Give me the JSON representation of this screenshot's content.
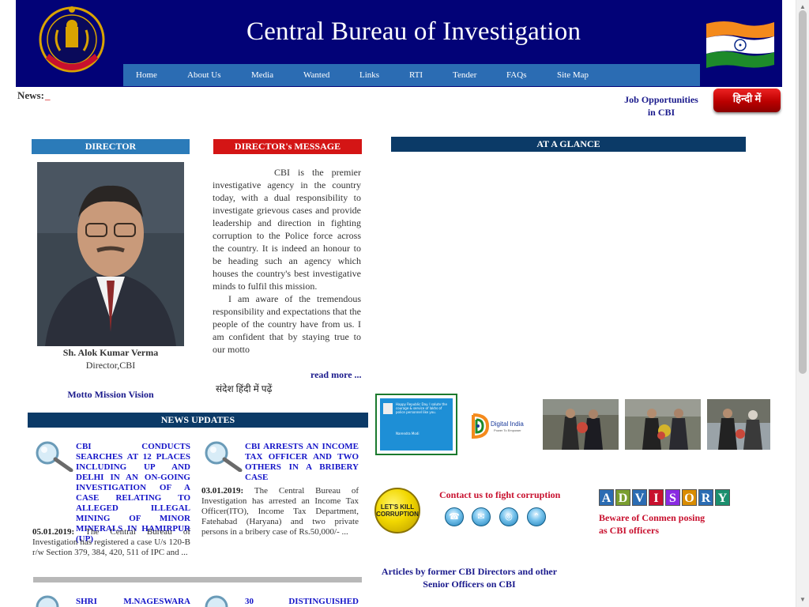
{
  "header": {
    "title": "Central Bureau of Investigation",
    "logo_icon": "cbi-emblem-icon",
    "flag_icon": "india-flag-icon",
    "nav": [
      {
        "label": "Home"
      },
      {
        "label": "About Us"
      },
      {
        "label": "Media"
      },
      {
        "label": "Wanted"
      },
      {
        "label": "Links"
      },
      {
        "label": "RTI"
      },
      {
        "label": "Tender"
      },
      {
        "label": "FAQs"
      },
      {
        "label": "Site Map"
      }
    ]
  },
  "ticker": {
    "label": "News:",
    "marker": "_"
  },
  "jobs": {
    "label_line1": "Job Opportunities",
    "label_line2": "in CBI"
  },
  "language_button": {
    "label": "हिन्दी में"
  },
  "director": {
    "section_title": "DIRECTOR",
    "name": "Sh. Alok Kumar Verma",
    "title": "Director,CBI",
    "motto_link": "Motto Mission Vision"
  },
  "message": {
    "section_title": "DIRECTOR's MESSAGE",
    "paragraph1": "CBI is the premier investigative agency in the country today, with a dual responsibility to investigate grievous cases and provide leadership and direction in fighting corruption to the Police force across the country. It is indeed an honour to be heading such an agency which houses the country's best investigative minds to fulfil this mission.",
    "paragraph2": "I am aware of the tremendous responsibility and expectations that the people of the country have from us. I am confident that by staying true to our motto",
    "read_more": "read more ...",
    "hindi_link": "संदेश हिंदी में पढ़ें"
  },
  "glance": {
    "section_title": "AT A GLANCE"
  },
  "fight_corruption": {
    "badge_line1": "LET'S KILL",
    "badge_line2": "CORRUPTION",
    "title": "Contact us to fight corruption",
    "icons": [
      "phone-icon",
      "mail-icon",
      "web-icon",
      "upload-icon"
    ]
  },
  "advisory": {
    "letters": [
      "A",
      "D",
      "V",
      "I",
      "S",
      "O",
      "R",
      "Y"
    ],
    "letter_colors": [
      "#2b6cb3",
      "#7a9e2f",
      "#2b6cb3",
      "#c8102e",
      "#8a2be2",
      "#d98c00",
      "#2b6cb3",
      "#1b8f6e"
    ],
    "warning_line1": "Beware of Conmen posing",
    "warning_line2": "as CBI officers"
  },
  "articles": {
    "line1": "Articles by former CBI Directors and other",
    "line2": "Senior Officers on CBI"
  },
  "news_updates": {
    "section_title": "NEWS UPDATES",
    "items": [
      {
        "headline": "CBI CONDUCTS SEARCHES AT 12 PLACES INCLUDING UP AND DELHI IN AN ON-GOING INVESTIGATION OF A CASE RELATING TO ALLEGED ILLEGAL MINING OF MINOR MINERALS IN HAMIRPUR (UP)",
        "date": "05.01.2019:",
        "body": "The Central Bureau of Investigation has registered a case U/s 120-B r/w Section 379, 384, 420, 511 of IPC and ..."
      },
      {
        "headline": "CBI ARRESTS AN INCOME TAX OFFICER AND TWO OTHERS IN A BRIBERY CASE",
        "date": "03.01.2019:",
        "body": "The Central Bureau of Investigation has arrested an Income Tax Officer(ITO), Income Tax Department, Fatehabad (Haryana) and two private persons in a bribery case of Rs.50,000/- ..."
      },
      {
        "headline": "SHRI M.NAGESWARA"
      },
      {
        "headline": "30 DISTINGUISHED"
      }
    ]
  },
  "thumbnails": {
    "tweet_text": "Happy Republic Day. I salute the courage & service of lakhs of police personnel like you.",
    "tweet_name": "Narendra Modi",
    "digital_india": "Digital India",
    "digital_india_tag": "Power To Empower"
  }
}
